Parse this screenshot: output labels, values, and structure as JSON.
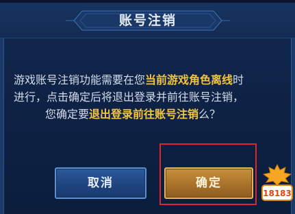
{
  "dialog": {
    "title": "账号注销",
    "message_line1_normal": "游戏账号注销功能需要在您",
    "message_line1_highlight": "当前游戏角色离线",
    "message_line1_tail": "时",
    "message_line2": "进行，点击确定后将退出登录并前往账号注销，",
    "message_line3_normal": "您确定要",
    "message_line3_highlight": "退出登录前往账号注销",
    "message_line3_tail": "么？"
  },
  "buttons": {
    "cancel_label": "取消",
    "confirm_label": "确定"
  },
  "watermark": {
    "text": "18183"
  },
  "colors": {
    "highlight_text": "#f2c53d",
    "annotation_box": "#e0262c",
    "confirm_button": "#a9722a",
    "cancel_button": "#1f4580"
  }
}
